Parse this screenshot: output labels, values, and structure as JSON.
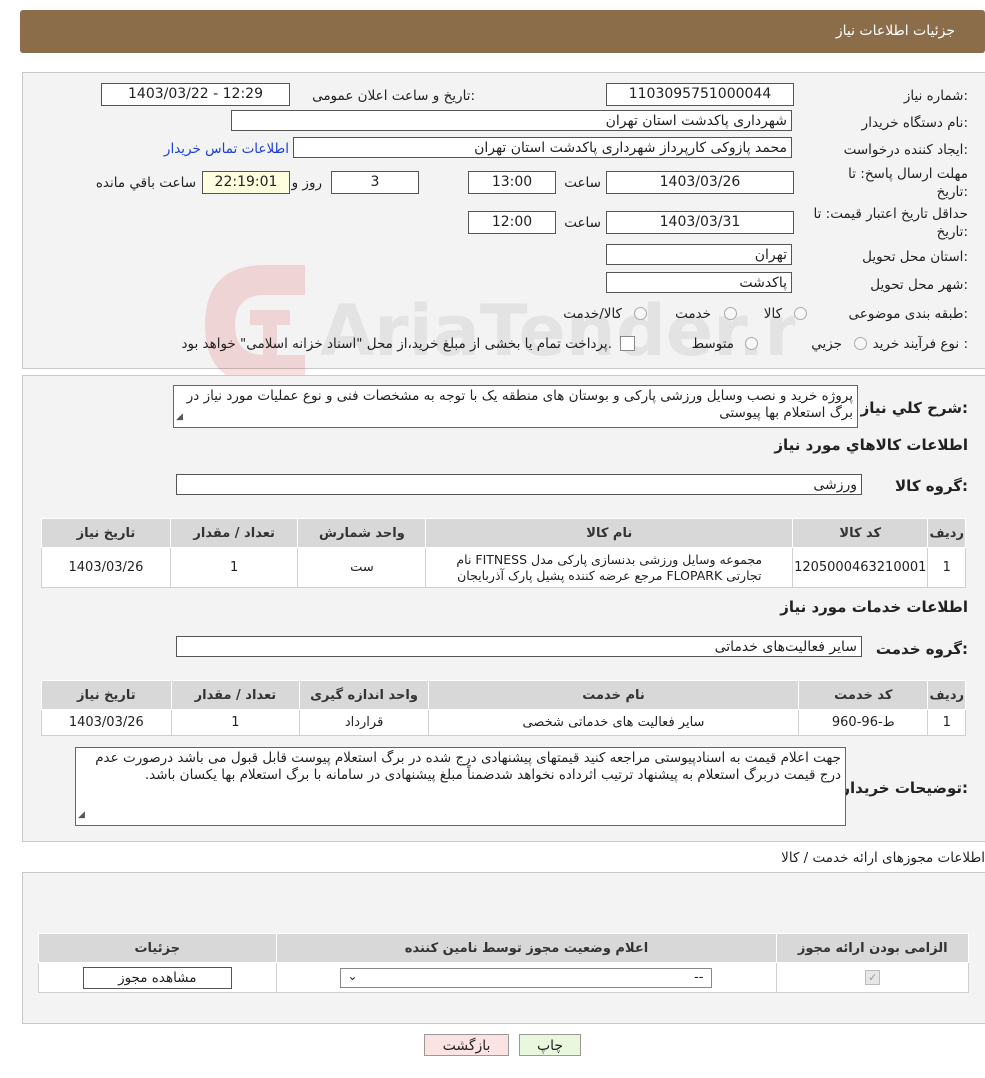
{
  "header": {
    "title": "جزئیات اطلاعات نیاز"
  },
  "form": {
    "need_number_label": "شماره نیاز:",
    "need_number": "1103095751000044",
    "announce_label": "تاریخ و ساعت اعلان عمومی:",
    "announce_value": "1403/03/22 - 12:29",
    "buyer_org_label": "نام دستگاه خریدار:",
    "buyer_org": "شهرداری پاکدشت استان تهران",
    "creator_label": "ایجاد کننده درخواست:",
    "creator": "محمد پازوکی کارپرداز شهرداری پاکدشت استان تهران",
    "contact_link": "اطلاعات تماس خریدار",
    "deadline_label_1": "مهلت ارسال پاسخ: تا",
    "deadline_label_2": "تاریخ:",
    "deadline_date": "1403/03/26",
    "time_label": "ساعت",
    "deadline_time": "13:00",
    "days": "3",
    "days_label": "روز و",
    "remaining_time": "22:19:01",
    "remaining_label": "ساعت باقي مانده",
    "validity_label_1": "حداقل تاریخ اعتبار قیمت: تا",
    "validity_label_2": "تاریخ:",
    "validity_date": "1403/03/31",
    "validity_time": "12:00",
    "province_label": "استان محل تحویل:",
    "province": "تهران",
    "city_label": "شهر محل تحویل:",
    "city": "پاکدشت",
    "category_label": "طبقه بندی موضوعی:",
    "category_options": [
      "کالا",
      "خدمت",
      "کالا/خدمت"
    ],
    "process_label": "نوع فرآیند خرید :",
    "process_options": [
      "جزیي",
      "متوسط"
    ],
    "process_note": "پرداخت تمام یا بخشی از مبلغ خرید،از محل \"اسناد خزانه اسلامی\" خواهد بود."
  },
  "description": {
    "label": "شرح کلي نياز:",
    "text": "پروژه خرید و نصب وسایل ورزشی پارکی و بوستان های منطقه یک با توجه به مشخصات فنی و نوع عملیات مورد نیاز در برگ استعلام بها پیوستی"
  },
  "goods": {
    "section_title": "اطلاعات کالاهاي مورد نياز",
    "group_label": "گروه کالا:",
    "group_value": "ورزشی",
    "headers": [
      "رديف",
      "کد کالا",
      "نام کالا",
      "واحد شمارش",
      "تعداد / مقدار",
      "تاريخ نياز"
    ],
    "rows": [
      {
        "idx": "1",
        "code": "1205000463210001",
        "name_line1": "مجموعه وسایل ورزشی بدنسازی پارکی مدل FITNESS نام",
        "name_line2": "تجارتی FLOPARK مرجع عرضه کننده پشیل پارک آذربایجان",
        "unit": "ست",
        "qty": "1",
        "date": "1403/03/26"
      }
    ]
  },
  "services": {
    "section_title": "اطلاعات خدمات مورد نياز",
    "group_label": "گروه خدمت:",
    "group_value": "سایر فعالیت‌های خدماتی",
    "headers": [
      "رديف",
      "کد خدمت",
      "نام خدمت",
      "واحد اندازه گيری",
      "تعداد / مقدار",
      "تاريخ نياز"
    ],
    "rows": [
      {
        "idx": "1",
        "code": "ط-96-960",
        "name": "سایر فعالیت های خدماتی شخصی",
        "unit": "قرارداد",
        "qty": "1",
        "date": "1403/03/26"
      }
    ]
  },
  "buyer_notes": {
    "label": "توضیحات خریدار:",
    "text": "جهت اعلام قیمت به اسنادپیوستی مراجعه کنید قیمتهای پیشنهادی درج شده در برگ استعلام پیوست قابل قبول می باشد درصورت عدم درج قیمت دربرگ استعلام به پیشنهاد ترتیب اثرداده نخواهد شدضمناً مبلغ پیشنهادی در سامانه با برگ استعلام بها یکسان باشد."
  },
  "permits": {
    "section_title": "اطلاعات مجوزهای ارائه خدمت / کالا",
    "headers": [
      "الزامی بودن ارائه مجوز",
      "اعلام وضعیت مجوز توسط نامین کننده",
      "جزئیات"
    ],
    "select_value": "--",
    "view_button": "مشاهده مجوز"
  },
  "footer": {
    "print_button": "چاپ",
    "back_button": "بازگشت"
  },
  "watermark": {
    "text": "AriaTender.neT"
  },
  "colors": {
    "header_bg": "#8b6d4a",
    "link": "#1a3fd6",
    "print_bg": "#eaf7df",
    "back_bg": "#fbe3e3"
  }
}
